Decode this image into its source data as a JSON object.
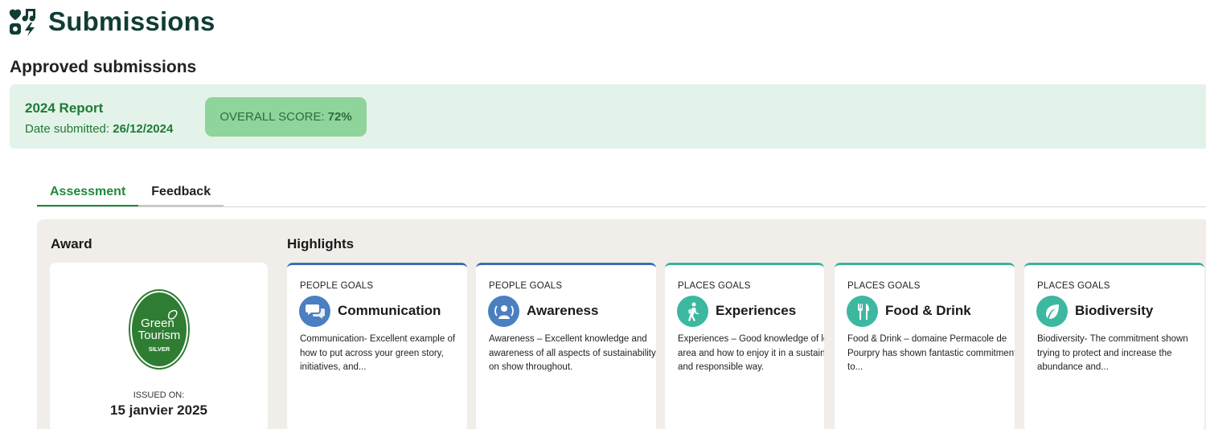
{
  "header": {
    "title": "Submissions",
    "logo_icon": "heart-music-bolt-logo"
  },
  "section": {
    "title": "Approved submissions"
  },
  "report": {
    "name": "2024 Report",
    "date_label": "Date submitted:",
    "date_value": "26/12/2024",
    "score_label": "OVERALL SCORE:",
    "score_value": "72%"
  },
  "tabs": [
    {
      "label": "Assessment",
      "active": true
    },
    {
      "label": "Feedback",
      "active": false
    }
  ],
  "award": {
    "heading": "Award",
    "badge_text_1": "Green",
    "badge_text_2": "Tourism",
    "badge_level": "SILVER",
    "issued_label": "ISSUED ON:",
    "issued_date": "15 janvier 2025"
  },
  "highlights": {
    "heading": "Highlights",
    "cards": [
      {
        "category": "PEOPLE GOALS",
        "title": "Communication",
        "icon": "speech-bubbles-icon",
        "text": "Communication- Excellent example of how to put across your green story, initiatives, and..."
      },
      {
        "category": "PEOPLE GOALS",
        "title": "Awareness",
        "icon": "person-broadcast-icon",
        "text": "Awareness – Excellent knowledge and awareness of all aspects of sustainability on show throughout."
      },
      {
        "category": "PLACES GOALS",
        "title": "Experiences",
        "icon": "hiker-icon",
        "text": "Experiences – Good knowledge of local area and how to enjoy it in a sustainable and responsible way."
      },
      {
        "category": "PLACES GOALS",
        "title": "Food & Drink",
        "icon": "fork-knife-icon",
        "text": "Food & Drink – domaine Permacole de Pourpry has shown fantastic commitment to..."
      },
      {
        "category": "PLACES GOALS",
        "title": "Biodiversity",
        "icon": "leaf-icon",
        "text": "Biodiversity- The commitment shown trying to protect and increase the abundance and..."
      }
    ]
  },
  "colors": {
    "brand_dark": "#113c36",
    "accent_green": "#1f8a3a",
    "people_accent": "#3b6fb0",
    "places_accent": "#39b39c",
    "banner_bg": "#e3f3ea"
  }
}
